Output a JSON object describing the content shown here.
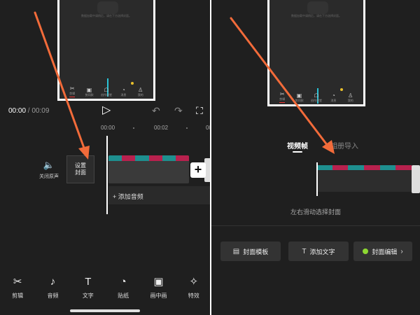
{
  "preview": {
    "blurb": "数据加载中请稍后，请在下方选择封面。",
    "tabs": [
      {
        "icon": "✂",
        "label": "剪辑"
      },
      {
        "icon": "▣",
        "label": "剪同款"
      },
      {
        "icon": "☖",
        "label": "创作课堂"
      },
      {
        "icon": "◔",
        "label": "消息"
      },
      {
        "icon": "♙",
        "label": "我的"
      }
    ]
  },
  "player": {
    "current_time": "00:00",
    "separator": " / ",
    "total_time": "00:09",
    "play_icon": "▷",
    "undo_icon": "↶",
    "redo_icon": "↷",
    "fullscreen_icon": "⛶"
  },
  "timeline": {
    "ruler": [
      "00:00",
      "00:02",
      "00:"
    ],
    "mute_icon": "🔈",
    "mute_label": "关闭原声",
    "cover_line1": "设置",
    "cover_line2": "封面",
    "add_clip_icon": "+",
    "add_audio_label": "+ 添加音频"
  },
  "toolbar": {
    "items": [
      {
        "icon": "✂",
        "label": "剪辑"
      },
      {
        "icon": "♪",
        "label": "音频"
      },
      {
        "icon": "T",
        "label": "文字"
      },
      {
        "icon": "◔",
        "label": "贴纸"
      },
      {
        "icon": "▣",
        "label": "画中画"
      },
      {
        "icon": "✧",
        "label": "特效"
      }
    ]
  },
  "cover_panel": {
    "tab_video_frame": "视频帧",
    "tab_album_import": "相册导入",
    "hint": "左右滑动选择封面",
    "btn_template": "封面模板",
    "btn_template_icon": "▤",
    "btn_text": "添加文字",
    "btn_text_icon": "T",
    "btn_edit": "封面编辑",
    "btn_edit_chevron": "›"
  },
  "colors": {
    "arrow": "#f26b3a",
    "accent_cyan": "#29c3d6",
    "clip_teal": "#1e8f8f",
    "clip_pink": "#b8214e",
    "edit_dot": "#8ed832"
  }
}
